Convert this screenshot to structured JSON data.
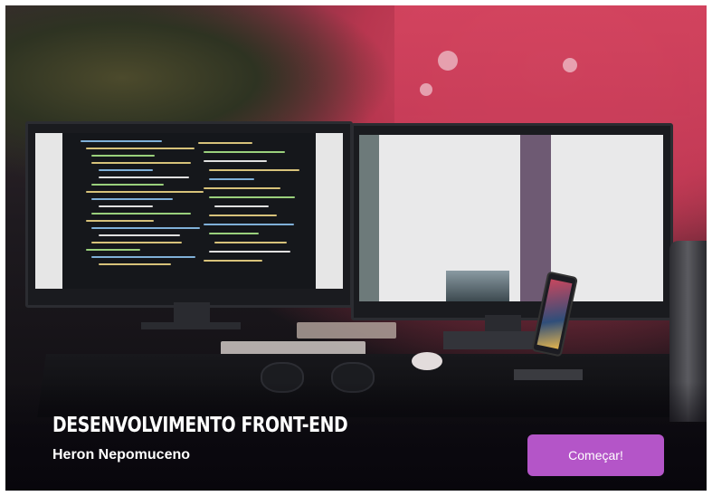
{
  "hero": {
    "title": "DESENVOLVIMENTO FRONT-END",
    "subtitle": "Heron Nepomuceno",
    "cta_label": "Começar!",
    "colors": {
      "cta_background": "#b455c8",
      "text": "#ffffff",
      "overlay": "#0a080e"
    }
  }
}
